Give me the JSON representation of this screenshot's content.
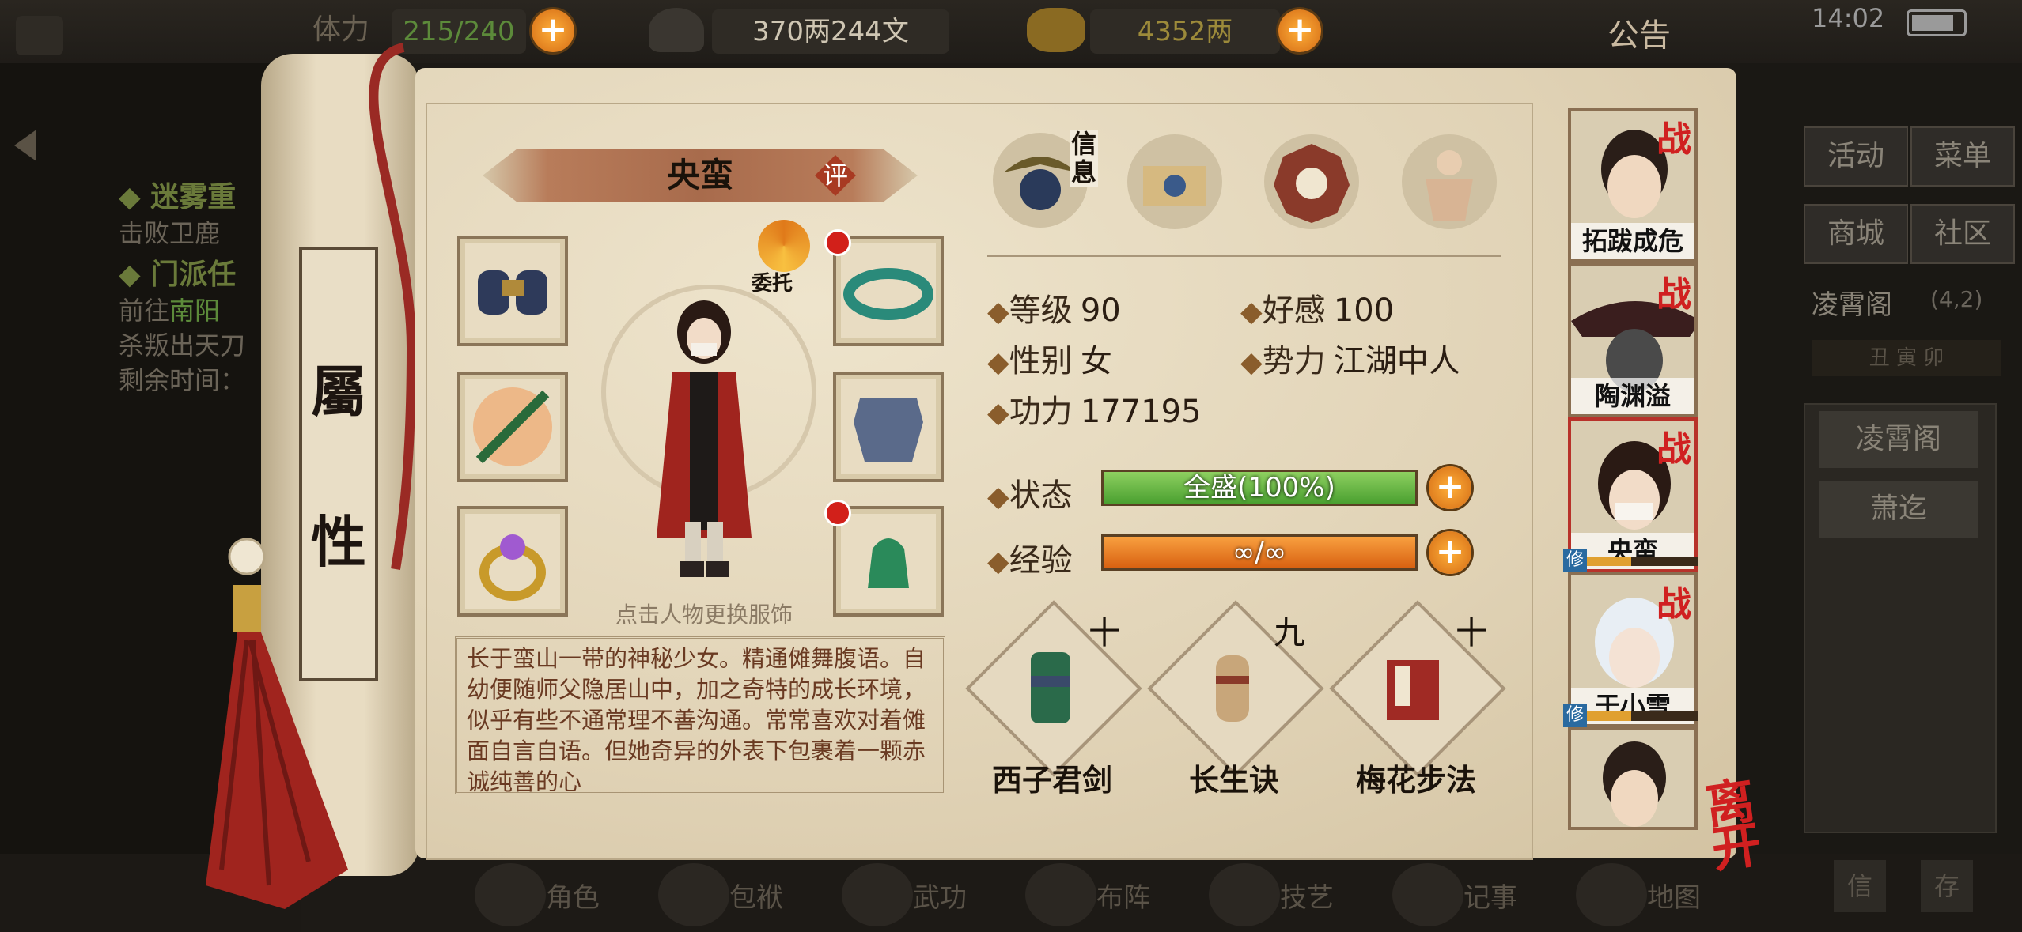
{
  "topbar": {
    "stamina_label": "体力",
    "stamina_value": "215/240",
    "silver_value": "370两244文",
    "gold_value": "4352两",
    "notice_label": "公告",
    "clock": "14:02"
  },
  "quests": {
    "q1_title": "◆ 迷雾重",
    "q1_line": "击败卫鹿",
    "q2_title": "◆ 门派任",
    "q2_line1_prefix": "前往",
    "q2_line1_place": "南阳",
    "q2_line2": "杀叛出天刀",
    "q2_line3": "剩余时间："
  },
  "scroll": {
    "title_top": "屬",
    "title_bottom": "性"
  },
  "character": {
    "name": "央蛮",
    "rate_label": "评",
    "entrust_label": "委托",
    "change_outfit_hint": "点击人物更换服饰",
    "description": "长于蛮山一带的神秘少女。精通傩舞腹语。自幼便随师父隐居山中，加之奇特的成长环境，似乎有些不通常理不善沟通。常常喜欢对着傩面自言自语。但她奇异的外表下包裹着一颗赤诚纯善的心"
  },
  "tabs": {
    "info_label": "信息"
  },
  "stats": {
    "level_label": "等级",
    "level_value": "90",
    "affinity_label": "好感",
    "affinity_value": "100",
    "gender_label": "性别",
    "gender_value": "女",
    "faction_label": "势力",
    "faction_value": "江湖中人",
    "power_label": "功力",
    "power_value": "177195",
    "status_label": "状态",
    "status_value": "全盛(100%)",
    "status_fraction": 1.0,
    "exp_label": "经验",
    "exp_value": "∞/∞",
    "exp_fraction": 1.0
  },
  "skills": [
    {
      "name": "西子君剑",
      "level": "十"
    },
    {
      "name": "长生诀",
      "level": "九"
    },
    {
      "name": "梅花步法",
      "level": "十"
    }
  ],
  "party": [
    {
      "name": "拓跋成危",
      "battle": "战"
    },
    {
      "name": "陶渊溢",
      "battle": "战"
    },
    {
      "name": "央蛮",
      "battle": "战",
      "cultivate": "修"
    },
    {
      "name": "于小雪",
      "battle": "战",
      "cultivate": "修"
    },
    {
      "name": ""
    }
  ],
  "right_menu": {
    "activity": "活动",
    "menu": "菜单",
    "shop": "商城",
    "community": "社区",
    "location": "凌霄阁",
    "coords": "(4,2)",
    "time_marks": "丑 寅 卯",
    "loc_button1": "凌霄阁",
    "loc_button2": "萧迄",
    "bottom1": "信",
    "bottom2": "存"
  },
  "leave_label": "离开",
  "bottom_nav": [
    "角色",
    "包袱",
    "武功",
    "布阵",
    "技艺",
    "记事",
    "地图"
  ],
  "colors": {
    "accent": "#d36a14",
    "status_green": "#5cb83a",
    "exp_orange": "#e0761a",
    "battle_red": "#d02020"
  }
}
